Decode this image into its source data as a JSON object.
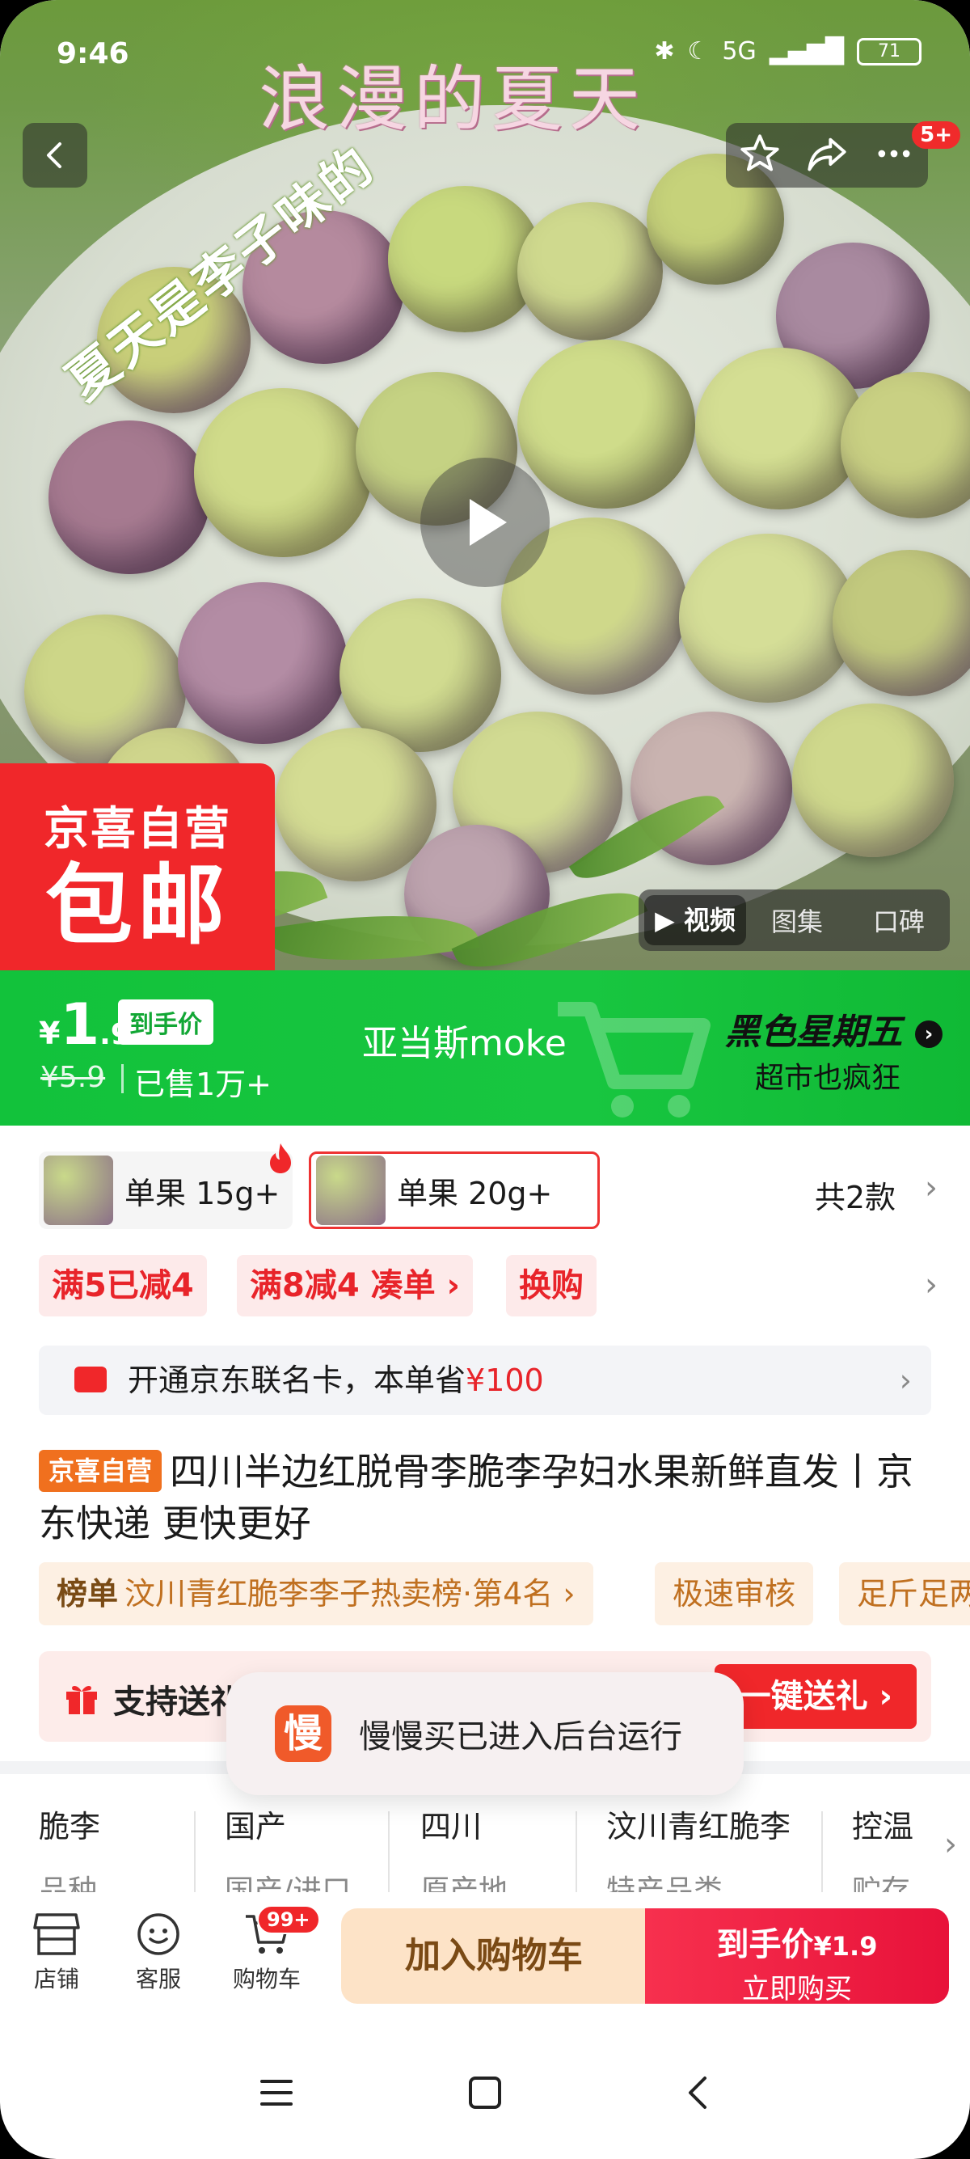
{
  "status_bar": {
    "time": "9:46",
    "network": "5G",
    "battery": "71"
  },
  "hero": {
    "caption_top": "浪漫的夏天",
    "caption_diag": "夏天是李子味的",
    "notification_badge": "5+",
    "corner_badge": {
      "line1": "京喜自营",
      "line2": "包邮"
    },
    "media_tabs": [
      "视频",
      "图集",
      "口碑"
    ]
  },
  "price_banner": {
    "symbol": "¥",
    "price_int": "1",
    "price_dec": ".9",
    "price_tag": "到手价",
    "original_price": "¥5.9",
    "sold": "已售1万+",
    "shop_name": "亚当斯moke",
    "promo_title": "黑色星期五",
    "promo_subtitle": "超市也疯狂"
  },
  "variants": {
    "items": [
      {
        "label": "单果 15g+"
      },
      {
        "label": "单果 20g+"
      }
    ],
    "count_label": "共2款"
  },
  "coupons": [
    "满5已减4",
    "满8减4",
    "凑单",
    "换购"
  ],
  "member_card": {
    "text": "开通京东联名卡，本单省",
    "amount": "¥100"
  },
  "product": {
    "tag": "京喜自营",
    "title": "四川半边红脱骨李脆李孕妇水果新鲜直发丨京东快递 更快更好"
  },
  "rank_row": {
    "rank_label": "榜单",
    "rank_text": "汶川青红脆李李子热卖榜·第4名",
    "chip2": "极速审核",
    "chip3": "足斤足两"
  },
  "gift_row": {
    "text": "支持送礼",
    "button": "一键送礼"
  },
  "toast": {
    "icon_char": "慢",
    "message": "慢慢买已进入后台运行"
  },
  "specs": [
    {
      "value": "脆李",
      "key": "品种"
    },
    {
      "value": "国产",
      "key": "国产/进口"
    },
    {
      "value": "四川",
      "key": "原产地"
    },
    {
      "value": "汶川青红脆李",
      "key": "特产品类"
    },
    {
      "value": "控温",
      "key": "贮存"
    }
  ],
  "bottom_bar": {
    "store": "店铺",
    "service": "客服",
    "cart": "购物车",
    "cart_badge": "99+",
    "add_to_cart": "加入购物车",
    "buy_line1": "到手价",
    "buy_price": "¥1.9",
    "buy_line2": "立即购买"
  },
  "colors": {
    "brand_red": "#f0272a",
    "banner_green": "#12c23b",
    "add_cart_bg": "#fde3c7"
  }
}
